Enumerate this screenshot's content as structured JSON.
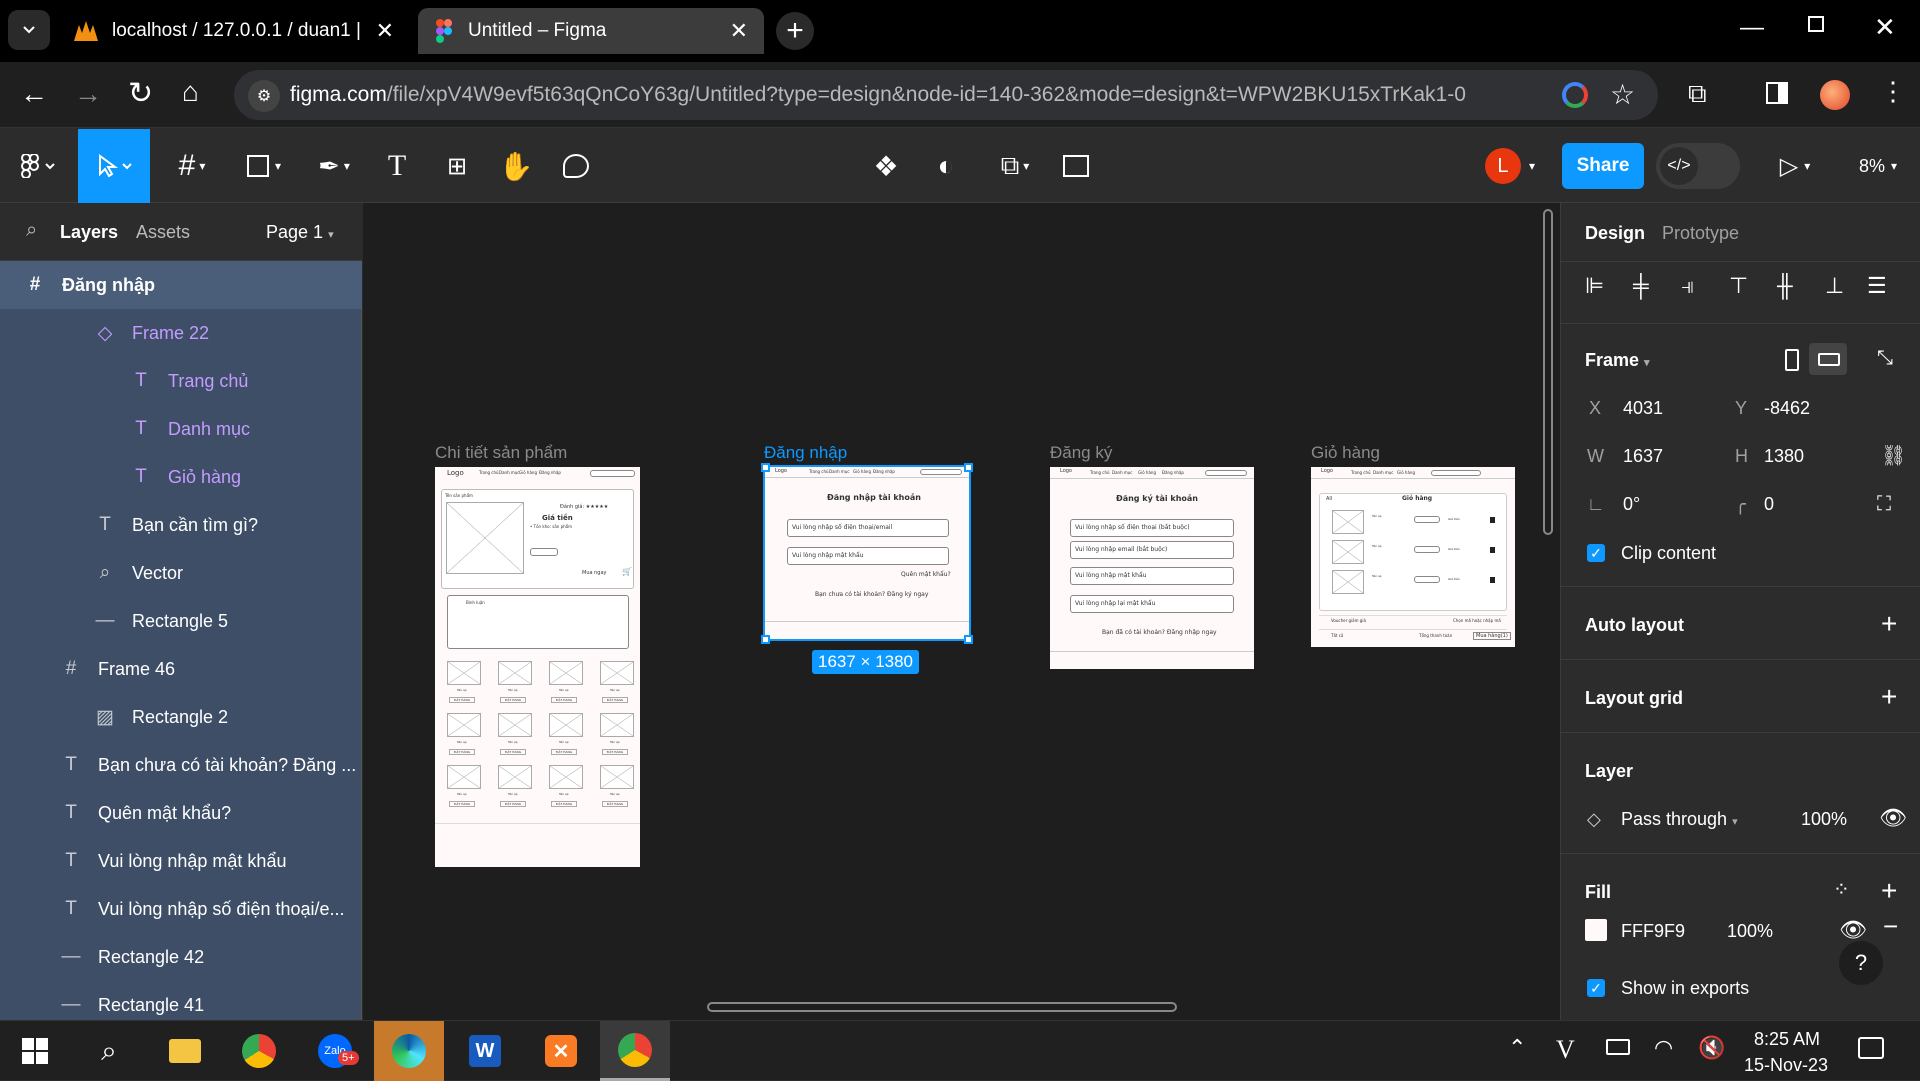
{
  "browser": {
    "tabs": [
      {
        "title": "localhost / 127.0.0.1 / duan1 | p",
        "icon": "phpmyadmin-icon"
      },
      {
        "title": "Untitled – Figma",
        "icon": "figma-icon"
      }
    ],
    "url_domain": "figma.com",
    "url_path": "/file/xpV4W9evf5t63qQnCoY63g/Untitled?type=design&node-id=140-362&mode=design&t=WPW2BKU15xTrKak1-0"
  },
  "figma": {
    "toolbar": {
      "share_label": "Share",
      "avatar_initial": "L",
      "zoom": "8%"
    },
    "left_panel": {
      "tabs": [
        "Layers",
        "Assets"
      ],
      "page": "Page 1",
      "layers": [
        {
          "name": "Đăng nhập",
          "type": "frame",
          "level": 0
        },
        {
          "name": "Frame 22",
          "type": "component",
          "level": 1
        },
        {
          "name": "Trang chủ",
          "type": "text",
          "level": 2
        },
        {
          "name": "Danh mục",
          "type": "text",
          "level": 2
        },
        {
          "name": "Giỏ hàng",
          "type": "text",
          "level": 2
        },
        {
          "name": "Bạn cần tìm gì?",
          "type": "text",
          "level": 1
        },
        {
          "name": "Vector",
          "type": "vector",
          "level": 1
        },
        {
          "name": "Rectangle 5",
          "type": "line",
          "level": 1
        },
        {
          "name": "Frame 46",
          "type": "frame",
          "level": 0
        },
        {
          "name": "Rectangle 2",
          "type": "image",
          "level": 1
        },
        {
          "name": "Bạn chưa có tài khoản? Đăng ...",
          "type": "text",
          "level": 0
        },
        {
          "name": "Quên mật khẩu?",
          "type": "text",
          "level": 0
        },
        {
          "name": "Vui lòng nhập mật khẩu",
          "type": "text",
          "level": 0
        },
        {
          "name": "Vui lòng nhập số điện thoại/e...",
          "type": "text",
          "level": 0
        },
        {
          "name": "Rectangle 42",
          "type": "line",
          "level": 0
        },
        {
          "name": "Rectangle 41",
          "type": "line",
          "level": 0
        }
      ]
    },
    "canvas": {
      "frames": [
        {
          "label": "Chi tiết sản phẩm"
        },
        {
          "label": "Đăng nhập"
        },
        {
          "label": "Đăng ký"
        },
        {
          "label": "Giỏ hàng"
        }
      ],
      "selection_size": "1637 × 1380",
      "mock": {
        "logo": "Logo",
        "nav": [
          "Trang chủ",
          "Danh mục",
          "Giỏ hàng",
          "Đăng nhập"
        ],
        "search": "Bạn cần tìm gì?",
        "login": {
          "title": "Đăng nhập tài khoản",
          "phone": "Vui lòng nhập số điện thoại/email",
          "password": "Vui lòng nhập mật khẩu",
          "forgot": "Quên mật khẩu?",
          "signup": "Bạn chưa có tài khoản? Đăng ký ngay"
        },
        "register": {
          "title": "Đăng ký tài khoản",
          "phone": "Vui lòng nhập số điện thoại (bắt buộc)",
          "email": "Vui lòng nhập email (bắt buộc)",
          "password": "Vui lòng nhập mật khẩu",
          "repassword": "Vui lòng nhập lại mật khẩu",
          "login": "Bạn đã có tài khoản? Đăng nhập ngay"
        },
        "product": {
          "section": "Tên sản phẩm",
          "price": "Giá tiền",
          "rating": "Đánh giá: ★★★★★",
          "stock": "• Tồn kho: sản phẩm",
          "buy": "Mua ngay",
          "comment": "Bình luận",
          "item_name": "Tên sp",
          "order": "ĐẶT HÀNG"
        },
        "cart": {
          "title": "Giỏ hàng",
          "all": "All",
          "item": "Tên sp",
          "price": "Giá tiền",
          "voucher": "Voucher giảm giá",
          "voucher_pick": "Chọn mã hoặc nhập mã",
          "select_all": "Tất cả",
          "total": "Tổng thanh toán",
          "buy": "Mua hàng(1)"
        }
      }
    },
    "right_panel": {
      "tabs": [
        "Design",
        "Prototype"
      ],
      "frame_label": "Frame",
      "x": "4031",
      "y": "-8462",
      "w": "1637",
      "h": "1380",
      "rotation": "0°",
      "radius": "0",
      "clip_content": "Clip content",
      "auto_layout": "Auto layout",
      "layout_grid": "Layout grid",
      "layer": "Layer",
      "blend": "Pass through",
      "opacity": "100%",
      "fill": "Fill",
      "fill_hex": "FFF9F9",
      "fill_opacity": "100%",
      "show_in_exports": "Show in exports",
      "help": "?"
    }
  },
  "taskbar": {
    "time": "8:25 AM",
    "date": "15-Nov-23",
    "zalo_badge": "5+",
    "tray_letter": "V"
  },
  "colors": {
    "accent": "#0d99ff",
    "layers_bg": "#3d4e66",
    "component": "#c49cff",
    "frame_fill": "#fff9f9"
  }
}
